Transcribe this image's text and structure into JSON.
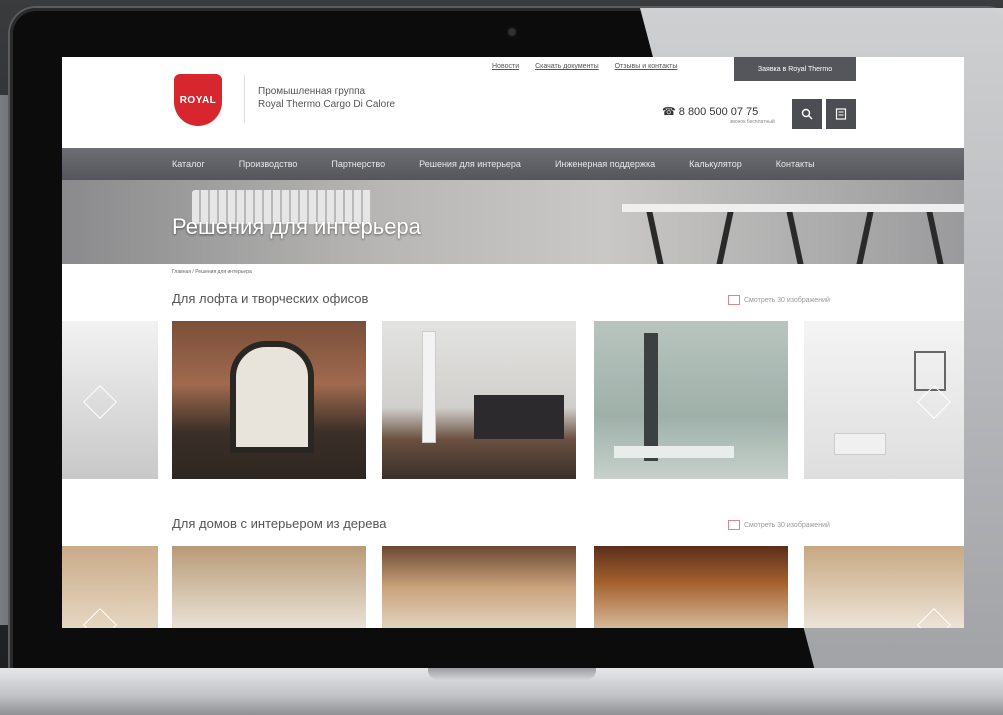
{
  "header": {
    "logo_text": "ROYAL",
    "company_line1": "Промышленная группа",
    "company_line2": "Royal Thermo Cargo Di Calore",
    "top_links": [
      "Новости",
      "Скачать документы",
      "Отзывы и контакты"
    ],
    "cta_label": "Заявка в Royal Thermo",
    "phone": "8 800 500 07 75",
    "phone_sub": "звонок бесплатный"
  },
  "nav": {
    "items": [
      "Каталог",
      "Производство",
      "Партнерство",
      "Решения для интерьера",
      "Инженерная поддержка",
      "Калькулятор",
      "Контакты"
    ]
  },
  "banner": {
    "title": "Решения для интерьера"
  },
  "breadcrumb": "Главная / Решения для интерьера",
  "sections": [
    {
      "title": "Для лофта и творческих офисов",
      "more": "Смотреть 30 изображений"
    },
    {
      "title": "Для домов с интерьером из дерева",
      "more": "Смотреть 30 изображений"
    }
  ],
  "colors": {
    "accent": "#d8262e",
    "nav": "#5f6066",
    "cta": "#55565b"
  }
}
